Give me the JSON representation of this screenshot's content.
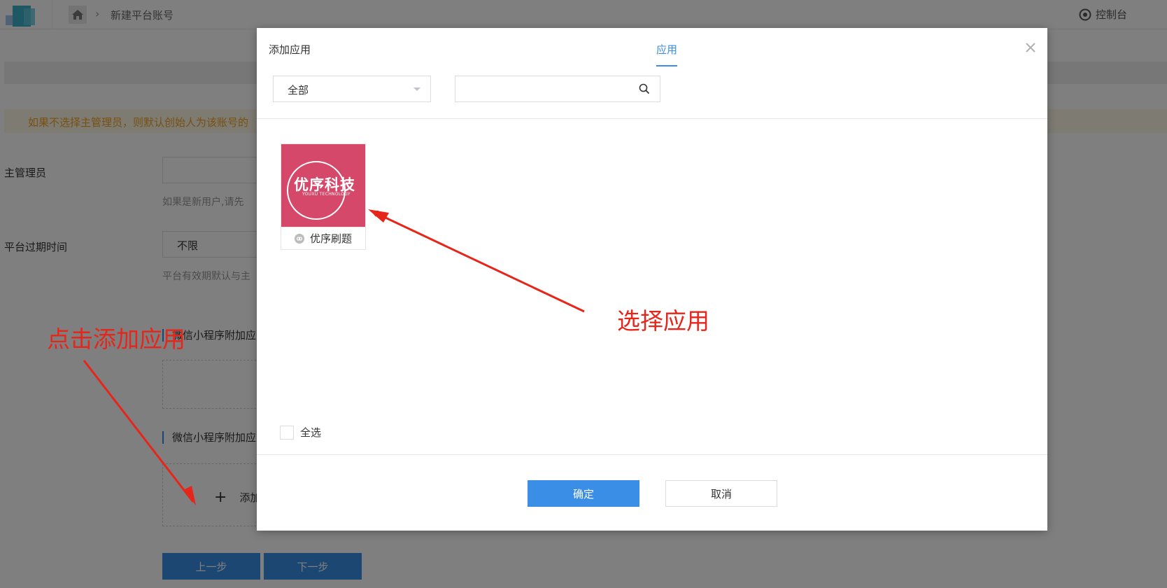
{
  "header": {
    "breadcrumb": "新建平台账号",
    "console_label": "控制台"
  },
  "page": {
    "warning": "如果不选择主管理员，则默认创始人为该账号的",
    "admin": {
      "label": "主管理员",
      "hint": "如果是新用户,请先"
    },
    "expire": {
      "label": "平台过期时间",
      "value": "不限",
      "hint": "平台有效期默认与主"
    },
    "section1_title": "微信小程序附加应",
    "section2_title": "微信小程序附加应",
    "add_app_label": "添加",
    "prev_button": "上一步",
    "next_button": "下一步"
  },
  "modal": {
    "title": "添加应用",
    "tab": "应用",
    "filter_value": "全部",
    "search_placeholder": "",
    "apps": [
      {
        "thumb_title": "优序科技",
        "thumb_subtitle": "YOUXU TECHNOLOGY",
        "name": "优序刷题"
      }
    ],
    "select_all_label": "全选",
    "confirm_button": "确定",
    "cancel_button": "取消"
  },
  "annotations": {
    "left_note": "点击添加应用",
    "right_note": "选择应用",
    "color": "#e6261b"
  },
  "colors": {
    "primary": "#3a8ee6",
    "app_thumb": "#d6486a",
    "warning_text": "#f0a020"
  }
}
